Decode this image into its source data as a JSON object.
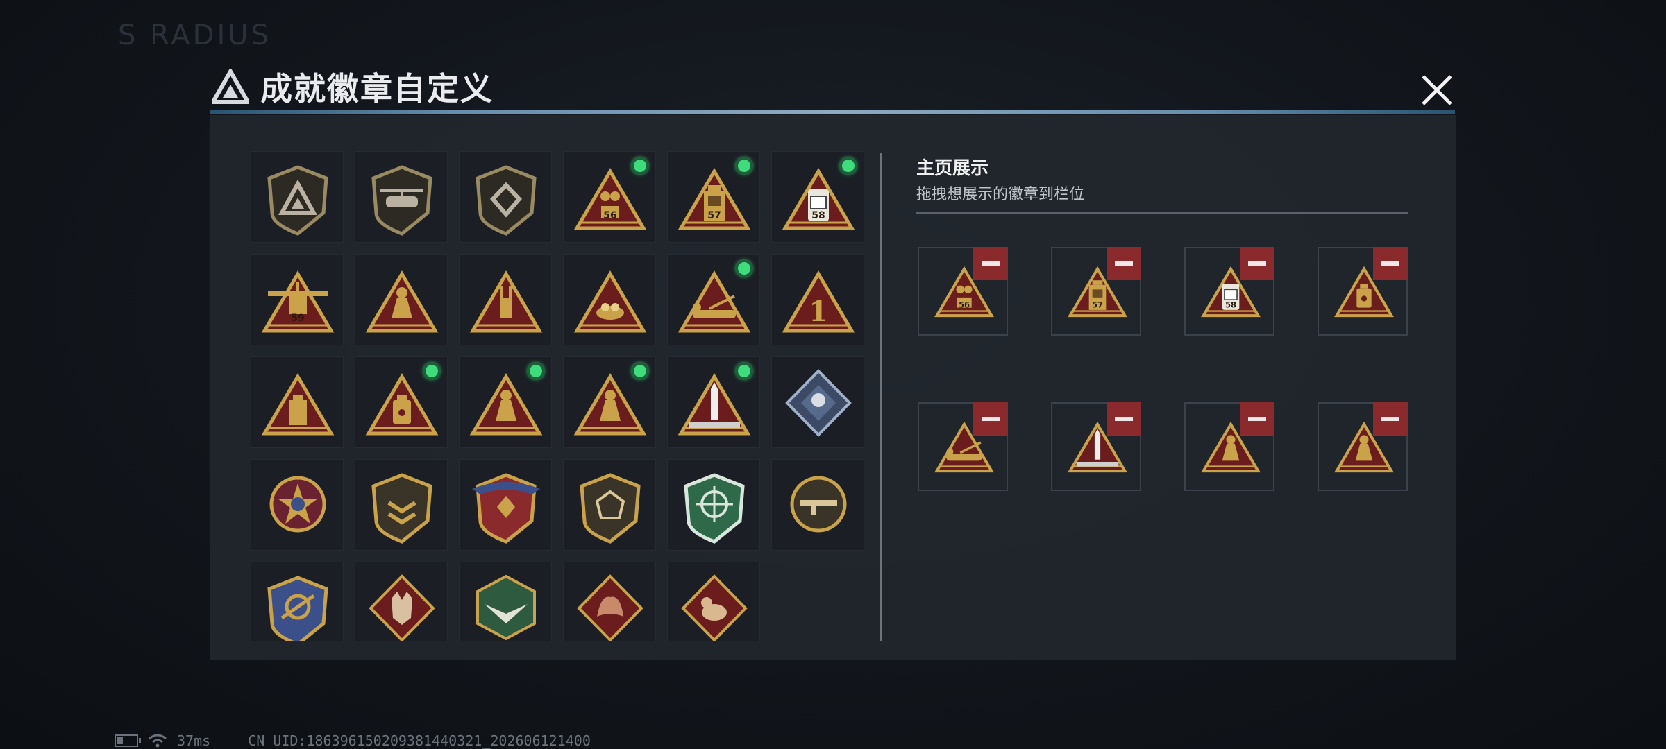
{
  "modal": {
    "title": "成就徽章自定义"
  },
  "showcase": {
    "title": "主页展示",
    "subtitle": "拖拽想展示的徽章到栏位",
    "slots": [
      {
        "badge": "badge-medal-56",
        "remove": true
      },
      {
        "badge": "badge-lantern-57",
        "remove": true
      },
      {
        "badge": "badge-canister-58",
        "remove": true
      },
      {
        "badge": "badge-bottle",
        "remove": true
      },
      {
        "badge": "badge-soldier-crawl",
        "remove": true
      },
      {
        "badge": "badge-rocket",
        "remove": true
      },
      {
        "badge": "badge-kneel-soldier",
        "remove": true
      },
      {
        "badge": "badge-dual-soldier",
        "remove": true
      }
    ]
  },
  "badges": [
    {
      "name": "badge-logo-shield",
      "selected": false
    },
    {
      "name": "badge-helicopter-shield",
      "selected": false
    },
    {
      "name": "badge-emblem-shield",
      "selected": false
    },
    {
      "name": "badge-medal-56",
      "label": "56",
      "selected": true
    },
    {
      "name": "badge-lantern-57",
      "label": "57",
      "selected": true
    },
    {
      "name": "badge-canister-58",
      "label": "58",
      "selected": true
    },
    {
      "name": "badge-plane-59",
      "label": "59",
      "selected": false
    },
    {
      "name": "badge-runner",
      "selected": false
    },
    {
      "name": "badge-hand-sign",
      "selected": false
    },
    {
      "name": "badge-nest",
      "selected": false
    },
    {
      "name": "badge-soldier-crawl",
      "selected": true
    },
    {
      "name": "badge-number-one",
      "label": "1",
      "selected": false
    },
    {
      "name": "badge-box",
      "selected": false
    },
    {
      "name": "badge-bottle",
      "selected": true
    },
    {
      "name": "badge-kneel-soldier",
      "selected": true
    },
    {
      "name": "badge-dual-soldier",
      "selected": true
    },
    {
      "name": "badge-rocket",
      "selected": true
    },
    {
      "name": "badge-blue-diamond",
      "selected": false
    },
    {
      "name": "badge-star-seal",
      "selected": false
    },
    {
      "name": "badge-chevron-shield",
      "selected": false
    },
    {
      "name": "badge-winged-shield",
      "selected": false
    },
    {
      "name": "badge-gem-shield",
      "selected": false
    },
    {
      "name": "badge-green-crosshair",
      "selected": false
    },
    {
      "name": "badge-rifle-shield",
      "selected": false
    },
    {
      "name": "badge-blue-crest",
      "selected": false
    },
    {
      "name": "badge-wolf-diamond",
      "selected": false
    },
    {
      "name": "badge-eagle-hex",
      "selected": false
    },
    {
      "name": "badge-dragon-diamond",
      "selected": false
    },
    {
      "name": "badge-dog-diamond",
      "selected": false
    }
  ],
  "status": {
    "ping": "37ms",
    "uid": "CN UID:186396150209381440321_202606121400"
  },
  "colors": {
    "accent": "#3fdc7e",
    "remove": "#8a2a2c",
    "gold": "#c9a24a",
    "maroon": "#6b1c1c"
  },
  "background_text": "S RADIUS"
}
